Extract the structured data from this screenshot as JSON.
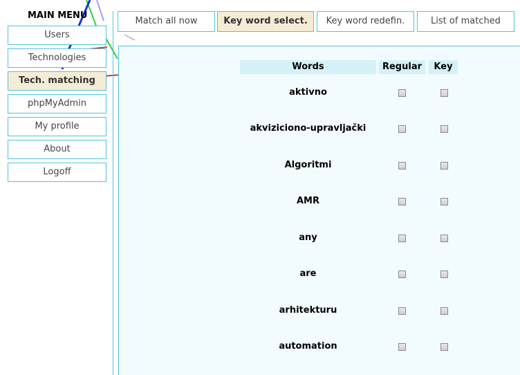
{
  "menu": {
    "title": "MAIN MENU",
    "items": [
      {
        "label": "Users"
      },
      {
        "label": "Technologies"
      },
      {
        "label": "Tech. matching"
      },
      {
        "label": "phpMyAdmin"
      },
      {
        "label": "My profile"
      },
      {
        "label": "About"
      },
      {
        "label": "Logoff"
      }
    ],
    "active_item": "Tech. matching"
  },
  "tabs": [
    {
      "label": "Match all now"
    },
    {
      "label": "Key word select."
    },
    {
      "label": "Key word redefin."
    },
    {
      "label": "List of matched"
    }
  ],
  "active_tab": "Key word select.",
  "table": {
    "headers": {
      "words": "Words",
      "regular": "Regular",
      "key": "Key"
    },
    "rows": [
      {
        "word": "aktivno",
        "regular": false,
        "key": false
      },
      {
        "word": "akviziciono-upravljački",
        "regular": false,
        "key": false
      },
      {
        "word": "Algoritmi",
        "regular": false,
        "key": false
      },
      {
        "word": "AMR",
        "regular": false,
        "key": false
      },
      {
        "word": "any",
        "regular": false,
        "key": false
      },
      {
        "word": "are",
        "regular": false,
        "key": false
      },
      {
        "word": "arhitekturu",
        "regular": false,
        "key": false
      },
      {
        "word": "automation",
        "regular": false,
        "key": false
      }
    ]
  },
  "colors": {
    "border": "#4fc3da",
    "active_bg": "#f5ecd6",
    "panel_bg": "#f2fbfd",
    "header_bg": "#d4f1f7"
  }
}
